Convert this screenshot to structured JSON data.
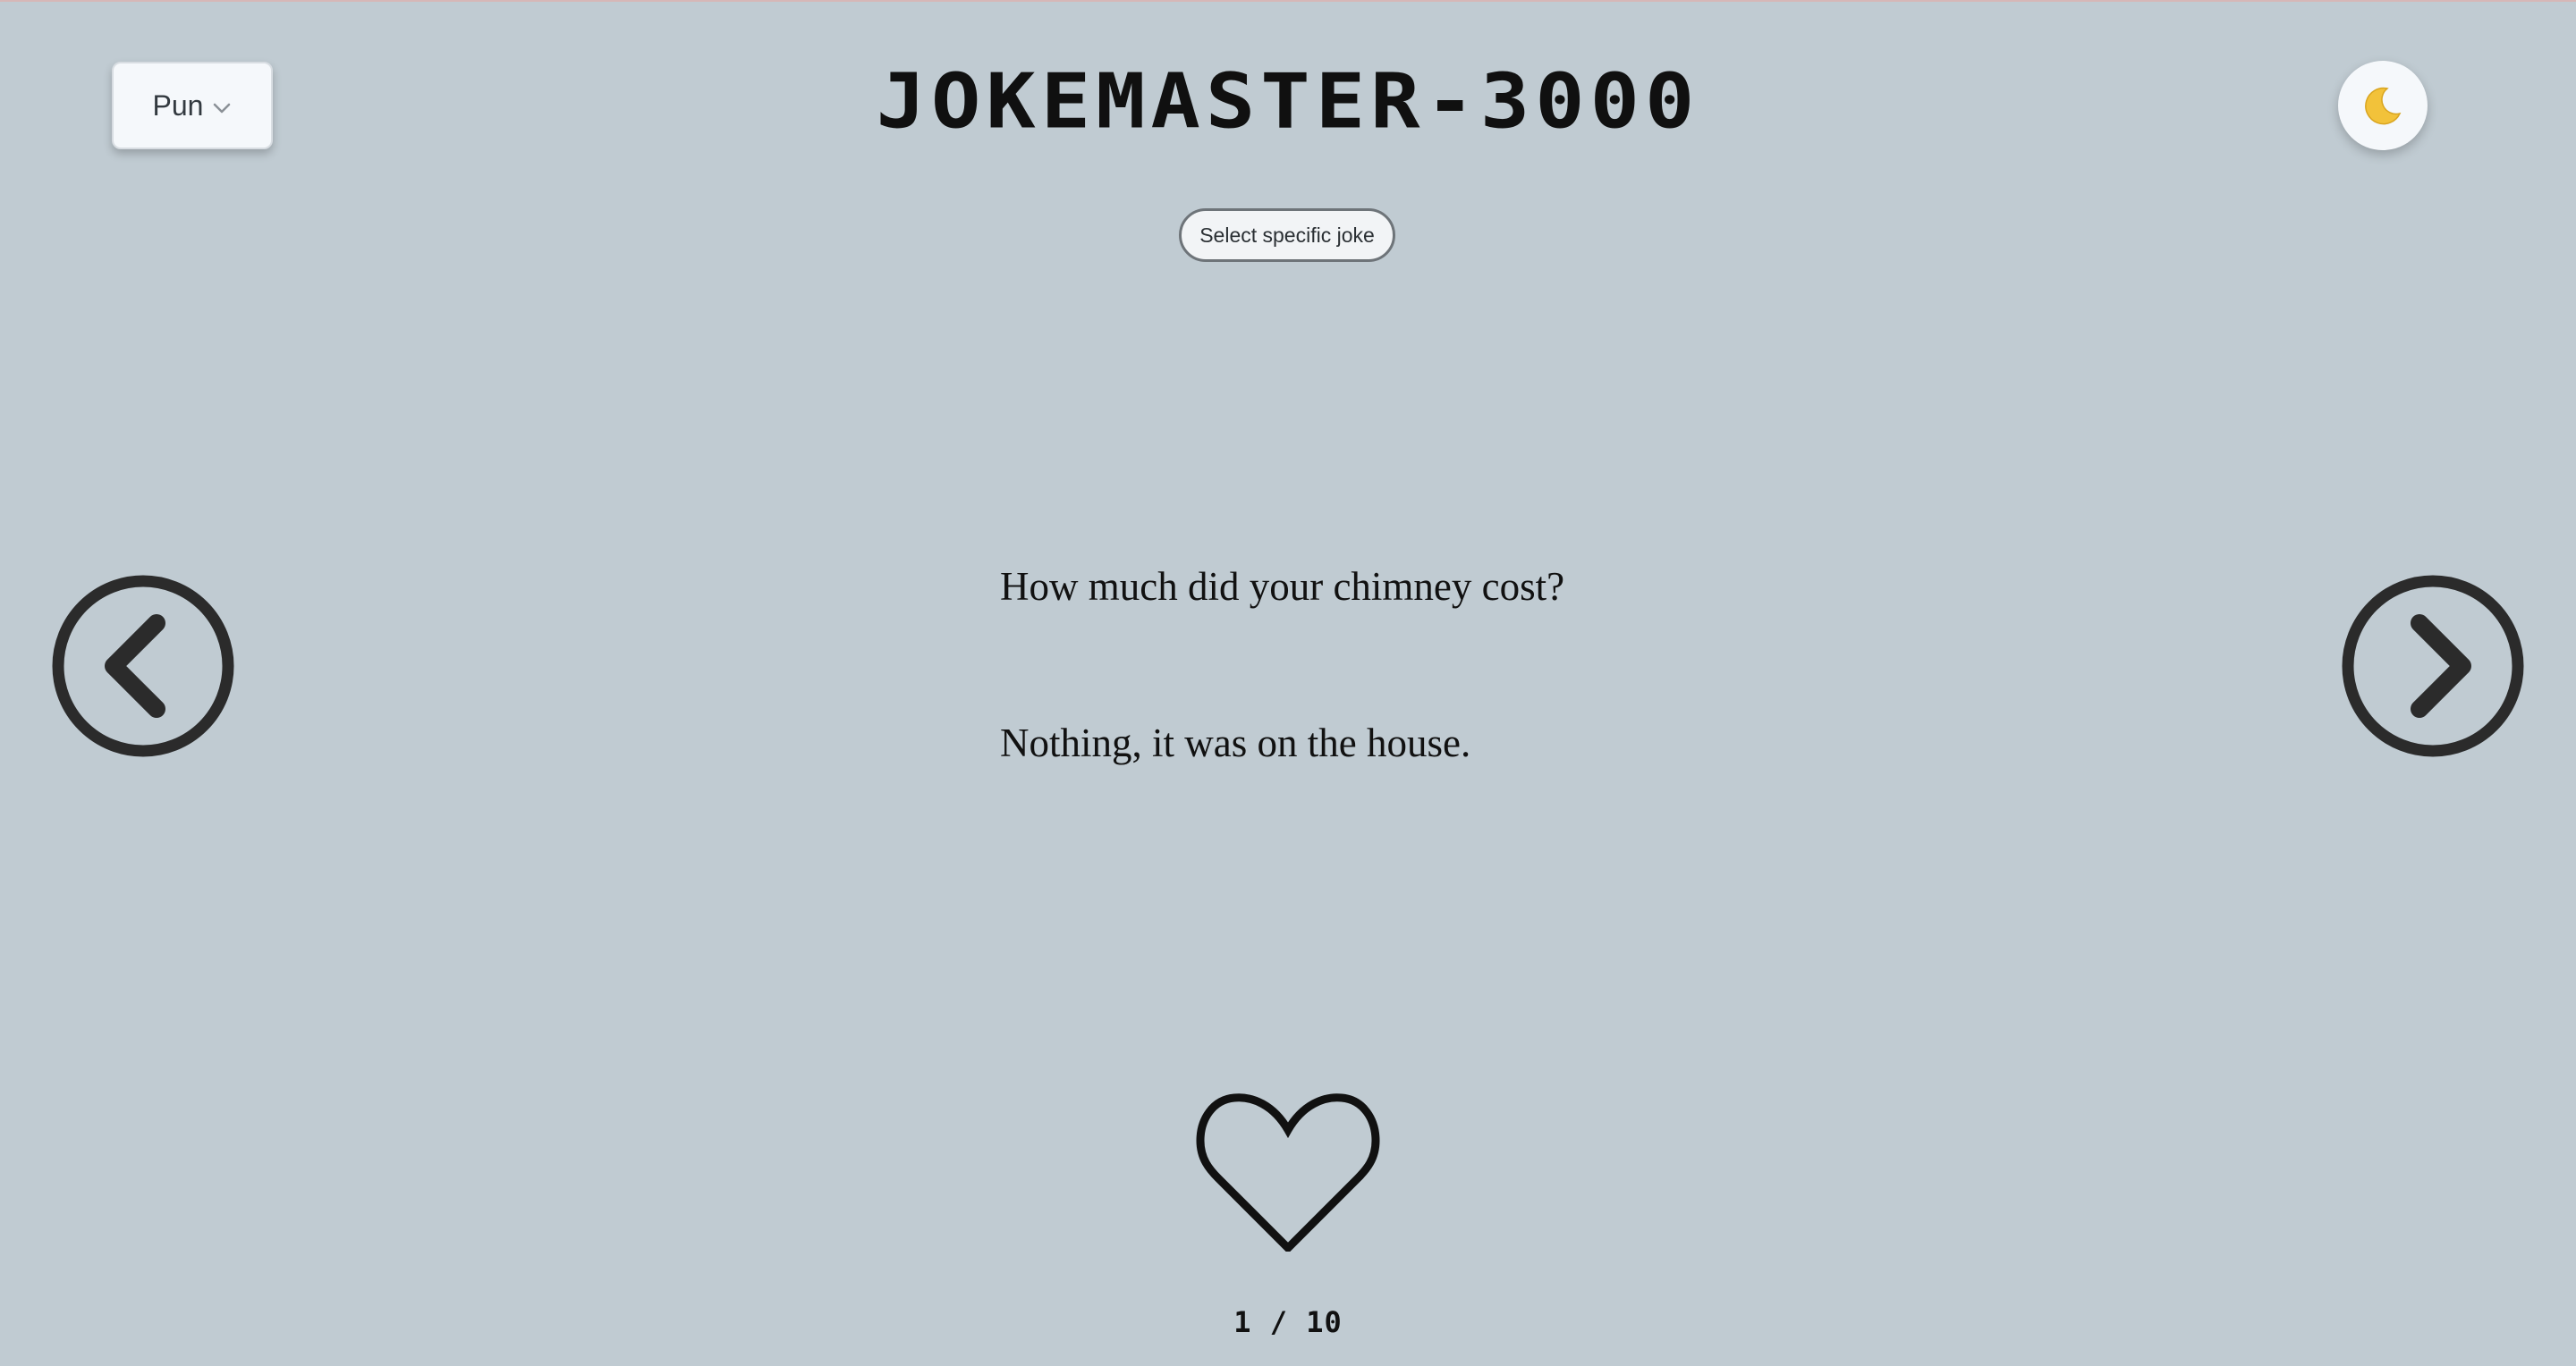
{
  "header": {
    "title": "JOKEMASTER-3000",
    "category_select": {
      "selected": "Pun",
      "icon": "chevron-down-icon"
    },
    "theme_toggle": {
      "icon": "moon-icon",
      "glyph": "🌙"
    }
  },
  "controls": {
    "select_joke_label": "Select specific joke"
  },
  "joke": {
    "setup": "How much did your chimney cost?",
    "punchline": "Nothing, it was on the house."
  },
  "navigation": {
    "prev_icon": "chevron-left-circle-icon",
    "next_icon": "chevron-right-circle-icon"
  },
  "favorite": {
    "icon": "heart-outline-icon",
    "liked": false
  },
  "pagination": {
    "text": "1 / 10",
    "current": 1,
    "total": 10
  },
  "colors": {
    "background": "#c0cbd2",
    "panel": "#f5f8fb",
    "icon_dark": "#2b2b2b"
  }
}
